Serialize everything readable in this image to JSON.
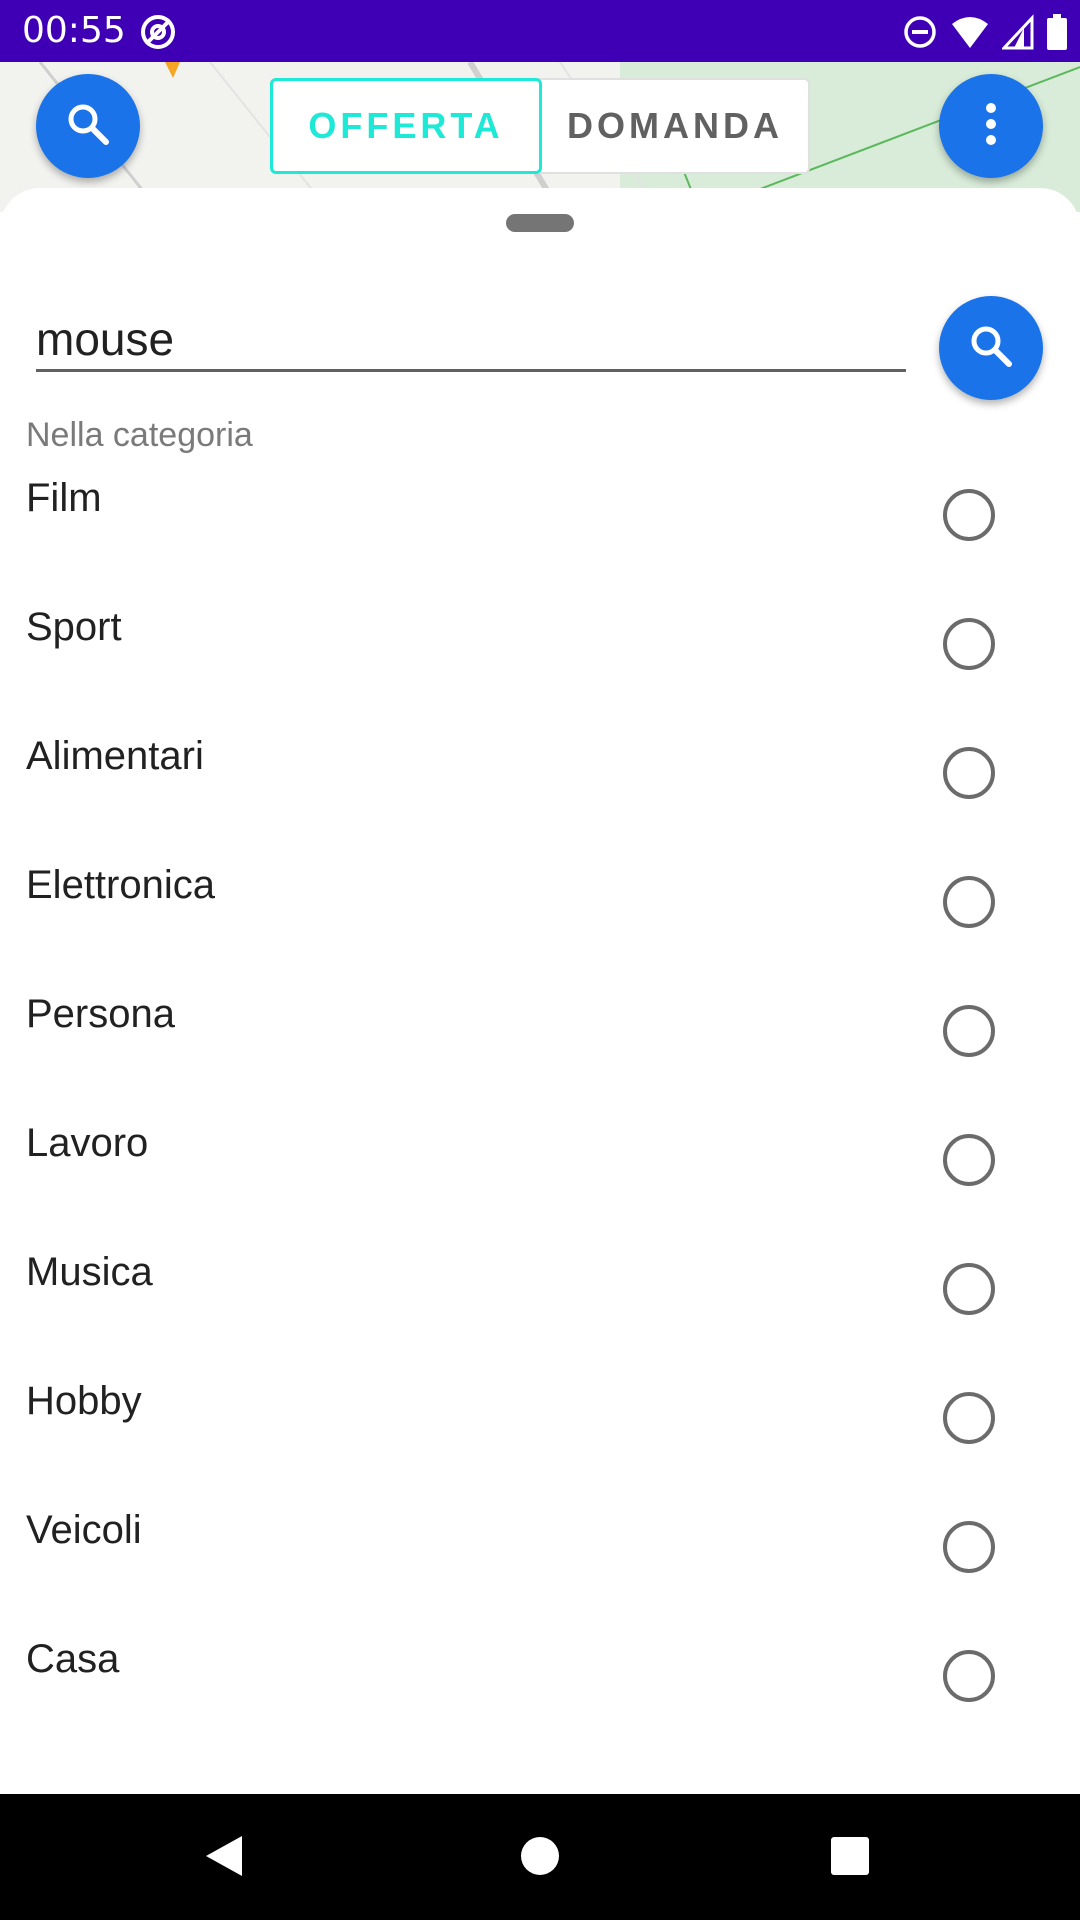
{
  "status_bar": {
    "time": "00:55",
    "left_icon": "data-saver-icon",
    "right_icons": [
      "do-not-disturb-icon",
      "wifi-icon",
      "signal-icon",
      "battery-icon"
    ]
  },
  "toggle": {
    "offerta_label": "OFFERTA",
    "domanda_label": "DOMANDA",
    "selected": "OFFERTA"
  },
  "search": {
    "value": "mouse",
    "placeholder": ""
  },
  "category_label": "Nella categoria",
  "categories": [
    {
      "label": "Film",
      "selected": false
    },
    {
      "label": "Sport",
      "selected": false
    },
    {
      "label": "Alimentari",
      "selected": false
    },
    {
      "label": "Elettronica",
      "selected": false
    },
    {
      "label": "Persona",
      "selected": false
    },
    {
      "label": "Lavoro",
      "selected": false
    },
    {
      "label": "Musica",
      "selected": false
    },
    {
      "label": "Hobby",
      "selected": false
    },
    {
      "label": "Veicoli",
      "selected": false
    },
    {
      "label": "Casa",
      "selected": false
    }
  ],
  "colors": {
    "status_bar": "#3f00b5",
    "fab": "#1a73e8",
    "toggle_active": "#1de9d6",
    "radio_border": "#6b6b6b"
  }
}
